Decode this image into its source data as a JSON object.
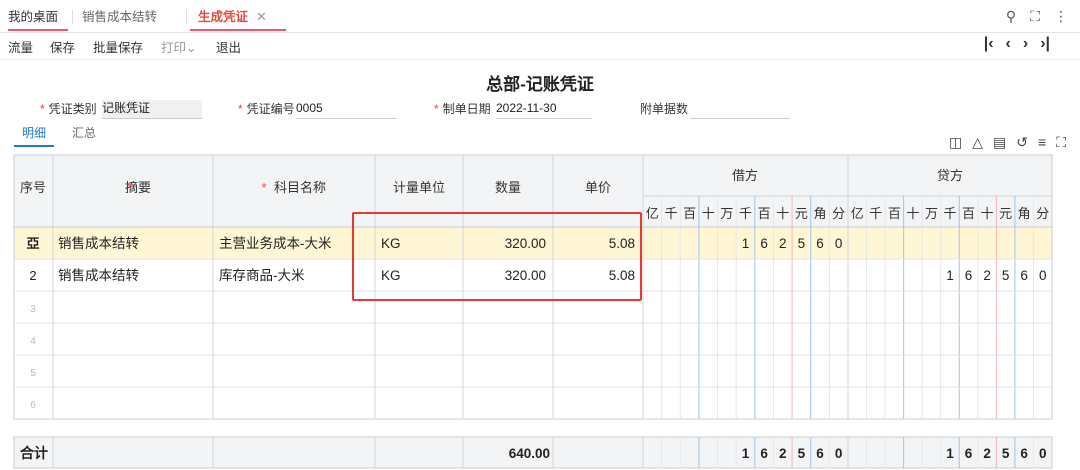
{
  "tabs": [
    {
      "label": "我的桌面"
    },
    {
      "label": "销售成本结转"
    },
    {
      "label": "生成凭证",
      "close": "✕"
    }
  ],
  "toolbar": {
    "items": [
      "流量",
      "保存",
      "批量保存",
      "打印⌄",
      "退出"
    ]
  },
  "voucher": {
    "title": "总部-记账凭证",
    "type_label": "凭证类别",
    "type_value": "记账凭证",
    "no_label": "凭证编号",
    "no_value": "0005",
    "date_label": "制单日期",
    "date_value": "2022-11-30",
    "attach_label": "附单据数",
    "attach_value": ""
  },
  "subtabs": [
    "明细",
    "汇总"
  ],
  "table": {
    "headers": {
      "seq": "序号",
      "summary": "摘要",
      "account": "科目名称",
      "unit": "计量单位",
      "qty": "数量",
      "price": "单价",
      "debit": "借方",
      "credit": "贷方"
    },
    "digit_headers": [
      "亿",
      "千",
      "百",
      "十",
      "万",
      "千",
      "百",
      "十",
      "元",
      "角",
      "分"
    ],
    "rows": [
      {
        "seq": "亞",
        "summary": "销售成本结转",
        "account": "主营业务成本-大米",
        "unit": "KG",
        "qty": "320.00",
        "price": "5.08",
        "debit": [
          "",
          "",
          "",
          "",
          "",
          "1",
          "6",
          "2",
          "5",
          "6",
          "0"
        ],
        "credit": [
          "",
          "",
          "",
          "",
          "",
          "",
          "",
          "",
          "",
          "",
          ""
        ]
      },
      {
        "seq": "2",
        "summary": "销售成本结转",
        "account": "库存商品-大米",
        "unit": "KG",
        "qty": "320.00",
        "price": "5.08",
        "debit": [
          "",
          "",
          "",
          "",
          "",
          "",
          "",
          "",
          "",
          "",
          ""
        ],
        "credit": [
          "",
          "",
          "",
          "",
          "",
          "1",
          "6",
          "2",
          "5",
          "6",
          "0"
        ]
      },
      {
        "seq": "3",
        "summary": "",
        "account": "",
        "unit": "",
        "qty": "",
        "price": "",
        "debit": [],
        "credit": []
      },
      {
        "seq": "4",
        "summary": "",
        "account": "",
        "unit": "",
        "qty": "",
        "price": "",
        "debit": [],
        "credit": []
      },
      {
        "seq": "5",
        "summary": "",
        "account": "",
        "unit": "",
        "qty": "",
        "price": "",
        "debit": [],
        "credit": []
      },
      {
        "seq": "6",
        "summary": "",
        "account": "",
        "unit": "",
        "qty": "",
        "price": "",
        "debit": [],
        "credit": []
      }
    ],
    "total": {
      "label": "合计",
      "qty": "640.00",
      "debit": [
        "",
        "",
        "",
        "",
        "",
        "1",
        "6",
        "2",
        "5",
        "6",
        "0"
      ],
      "credit": [
        "",
        "",
        "",
        "",
        "",
        "1",
        "6",
        "2",
        "5",
        "6",
        "0"
      ]
    }
  },
  "colors": {
    "accent": "#e8473c",
    "highlight": "#e53935",
    "active_row": "#fff6d6",
    "active_tab": "#1f78d1"
  }
}
